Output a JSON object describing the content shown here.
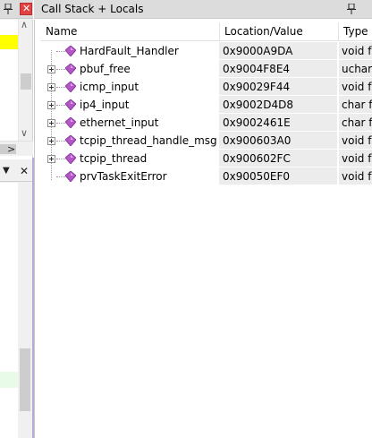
{
  "window": {
    "title": "Call Stack + Locals"
  },
  "columns": {
    "name": "Name",
    "location": "Location/Value",
    "type": "Type"
  },
  "rows": [
    {
      "name": "HardFault_Handler",
      "location": "0x9000A9DA",
      "type": "void f(",
      "expandable": false
    },
    {
      "name": "pbuf_free",
      "location": "0x9004F8E4",
      "type": "uchar f",
      "expandable": true
    },
    {
      "name": "icmp_input",
      "location": "0x90029F44",
      "type": "void f(",
      "expandable": true
    },
    {
      "name": "ip4_input",
      "location": "0x9002D4D8",
      "type": "char f(",
      "expandable": true
    },
    {
      "name": "ethernet_input",
      "location": "0x9002461E",
      "type": "char f(",
      "expandable": true
    },
    {
      "name": "tcpip_thread_handle_msg",
      "location": "0x900603A0",
      "type": "void f(",
      "expandable": true
    },
    {
      "name": "tcpip_thread",
      "location": "0x900602FC",
      "type": "void f(",
      "expandable": true
    },
    {
      "name": "prvTaskExitError",
      "location": "0x90050EF0",
      "type": "void f(",
      "expandable": false
    }
  ],
  "left_pane": {
    "lower_dropdown_glyph": "▼",
    "lower_close_glyph": "✕",
    "close_glyph": "✕",
    "up_arrow": "∧",
    "down_arrow": "∨",
    "right_arrow": ">"
  },
  "colors": {
    "title_bar": "#dcdcdc",
    "close_button": "#e04343",
    "highlight_yellow": "#ffff00",
    "gem": "#b455c8"
  },
  "icons": [
    "pin-icon",
    "close-icon",
    "function-gem-icon",
    "expand-plus-icon"
  ]
}
